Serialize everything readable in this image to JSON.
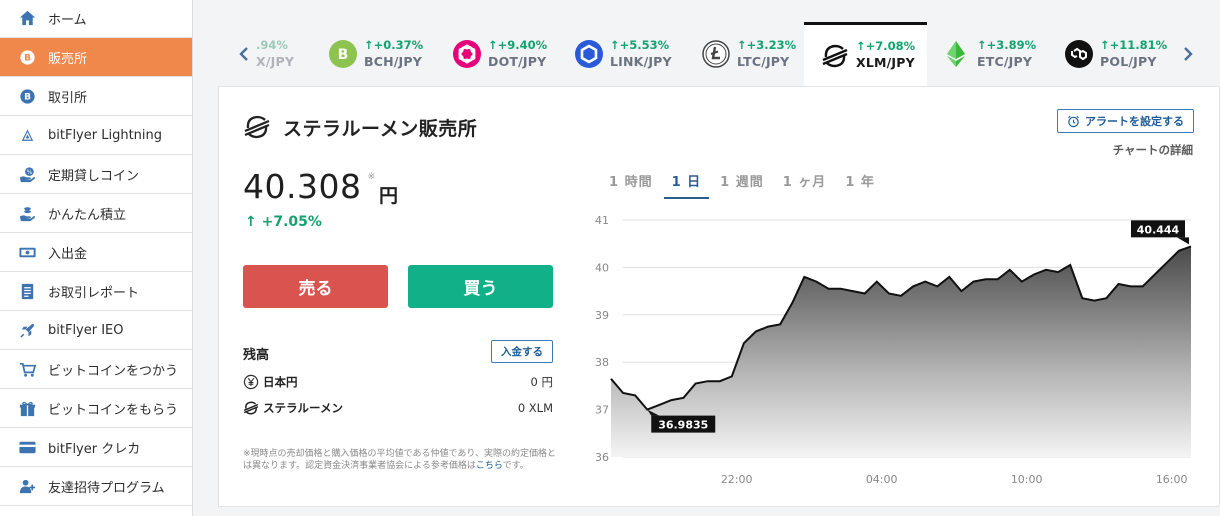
{
  "sidebar": {
    "items": [
      {
        "label": "ホーム",
        "icon": "home-icon",
        "active": false
      },
      {
        "label": "販売所",
        "icon": "bitcoin-icon",
        "active": true
      },
      {
        "label": "取引所",
        "icon": "bitcoin-icon",
        "active": false
      },
      {
        "label": "bitFlyer Lightning",
        "icon": "lightning-icon",
        "active": false
      },
      {
        "label": "定期貸しコイン",
        "icon": "lending-icon",
        "active": false
      },
      {
        "label": "かんたん積立",
        "icon": "savings-icon",
        "active": false
      },
      {
        "label": "入出金",
        "icon": "cash-icon",
        "active": false
      },
      {
        "label": "お取引レポート",
        "icon": "report-icon",
        "active": false
      },
      {
        "label": "bitFlyer IEO",
        "icon": "rocket-icon",
        "active": false
      },
      {
        "label": "ビットコインをつかう",
        "icon": "cart-icon",
        "active": false
      },
      {
        "label": "ビットコインをもらう",
        "icon": "gift-icon",
        "active": false
      },
      {
        "label": "bitFlyer クレカ",
        "icon": "credit-card-icon",
        "active": false
      },
      {
        "label": "友達招待プログラム",
        "icon": "invite-icon",
        "active": false
      }
    ]
  },
  "ticker": {
    "pairs": [
      {
        "change": ".94%",
        "name": "X/JPY",
        "coin": "partial"
      },
      {
        "change": "+0.37%",
        "name": "BCH/JPY",
        "coin": "bch"
      },
      {
        "change": "+9.40%",
        "name": "DOT/JPY",
        "coin": "dot"
      },
      {
        "change": "+5.53%",
        "name": "LINK/JPY",
        "coin": "link"
      },
      {
        "change": "+3.23%",
        "name": "LTC/JPY",
        "coin": "ltc"
      },
      {
        "change": "+7.08%",
        "name": "XLM/JPY",
        "coin": "xlm",
        "active": true
      },
      {
        "change": "+3.89%",
        "name": "ETC/JPY",
        "coin": "etc"
      },
      {
        "change": "+11.81%",
        "name": "POL/JPY",
        "coin": "pol"
      }
    ]
  },
  "card": {
    "title": "ステラルーメン販売所",
    "alert_label": "アラートを設定する",
    "detail_label": "チャートの詳細",
    "price": "40.308",
    "price_mark": "※",
    "price_unit": "円",
    "change": "+7.05%",
    "sell_label": "売る",
    "buy_label": "買う",
    "balance_title": "残高",
    "deposit_label": "入金する",
    "balances": [
      {
        "name": "日本円",
        "value": "0 円"
      },
      {
        "name": "ステラルーメン",
        "value": "0 XLM"
      }
    ],
    "note_text": "※現時点の売却価格と購入価格の平均値である仲値であり、実際の約定価格とは異なります。認定資金決済事業者協会による参考価格は",
    "note_link": "こちら",
    "note_tail": "です。"
  },
  "tabs": [
    {
      "label": "1 時間",
      "active": false
    },
    {
      "label": "1 日",
      "active": true
    },
    {
      "label": "1 週間",
      "active": false
    },
    {
      "label": "1 ヶ月",
      "active": false
    },
    {
      "label": "1 年",
      "active": false
    }
  ],
  "colors": {
    "accent": "#f0874b",
    "up": "#12a36f",
    "sell": "#d9534f",
    "buy": "#11b089",
    "link": "#1d5c99"
  },
  "chart_data": {
    "type": "area",
    "ylim": [
      36,
      41
    ],
    "yticks": [
      "36",
      "37",
      "38",
      "39",
      "40",
      "41"
    ],
    "xticks": [
      "22:00",
      "04:00",
      "10:00",
      "16:00"
    ],
    "xtick_positions": [
      5,
      11,
      17,
      23
    ],
    "x_range": [
      -0.2,
      23.8
    ],
    "values": [
      37.65,
      37.35,
      37.3,
      37.0,
      37.1,
      37.2,
      37.25,
      37.55,
      37.6,
      37.6,
      37.7,
      38.4,
      38.65,
      38.75,
      38.8,
      39.25,
      39.8,
      39.7,
      39.55,
      39.55,
      39.5,
      39.45,
      39.7,
      39.45,
      39.4,
      39.6,
      39.7,
      39.6,
      39.8,
      39.5,
      39.7,
      39.75,
      39.75,
      39.95,
      39.7,
      39.85,
      39.95,
      39.9,
      40.05,
      39.35,
      39.3,
      39.35,
      39.65,
      39.6,
      39.6,
      39.85,
      40.1,
      40.35,
      40.444
    ],
    "min_label": "36.9835",
    "max_label": "40.444"
  }
}
